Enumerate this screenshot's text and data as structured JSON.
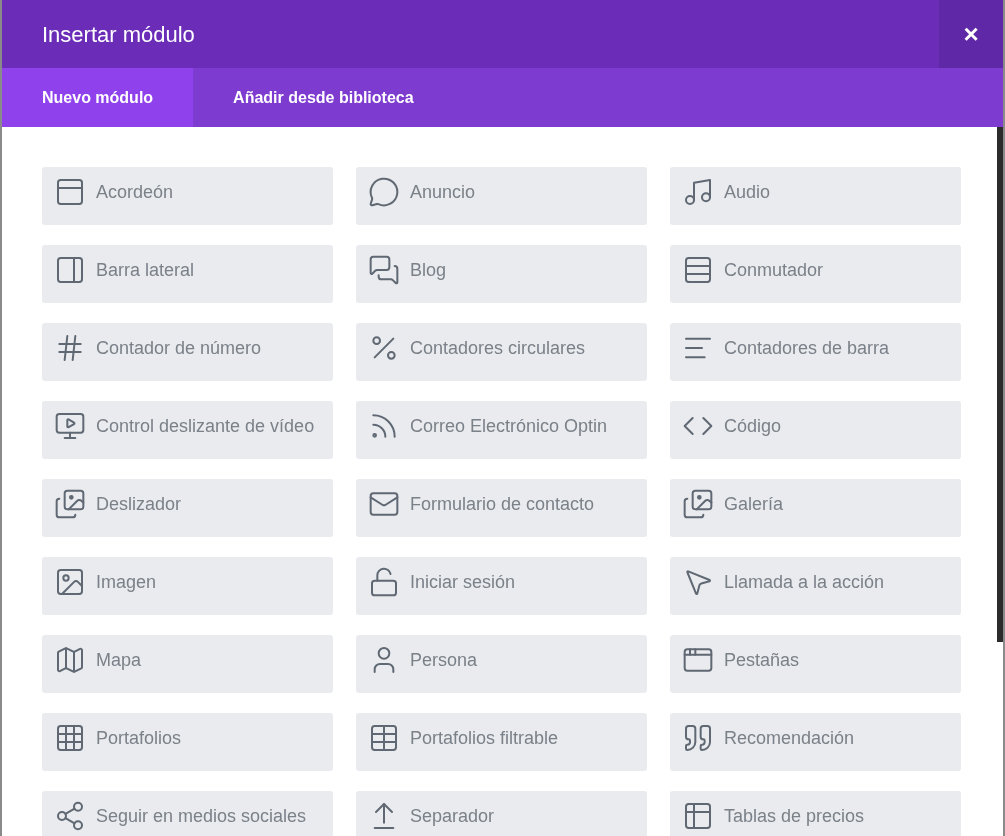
{
  "window": {
    "title": "Insertar módulo",
    "close": "×"
  },
  "tabs": [
    {
      "label": "Nuevo módulo",
      "selected": true
    },
    {
      "label": "Añadir desde biblioteca",
      "selected": false
    }
  ],
  "modules": [
    "Acordeón",
    "Anuncio",
    "Audio",
    "Barra lateral",
    "Blog",
    "Conmutador",
    "Contador de número",
    "Contadores circulares",
    "Contadores de barra",
    "Control deslizante de vídeo",
    "Correo Electrónico Optin",
    "Código",
    "Deslizador",
    "Formulario de contacto",
    "Galería",
    "Imagen",
    "Iniciar sesión",
    "Llamada a la acción",
    "Mapa",
    "Persona",
    "Pestañas",
    "Portafolios",
    "Portafolios filtrable",
    "Recomendación",
    "Seguir en medios sociales",
    "Separador",
    "Tablas de precios"
  ]
}
